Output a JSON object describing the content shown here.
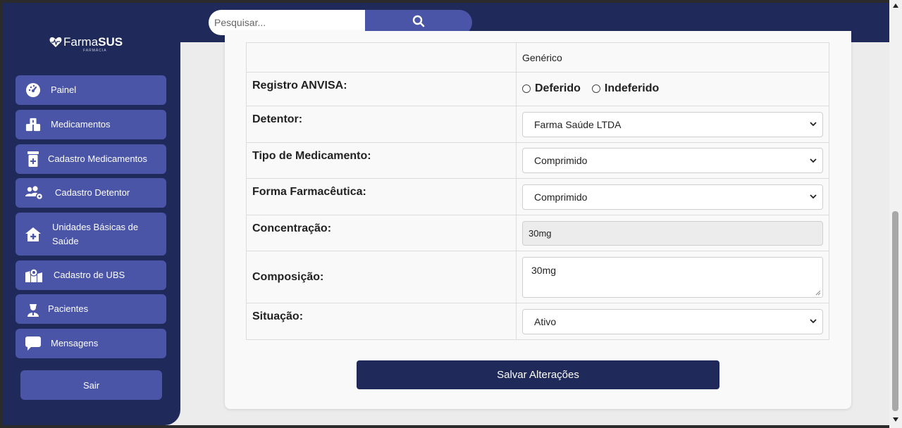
{
  "search": {
    "placeholder": "Pesquisar...",
    "button_icon": "search-icon"
  },
  "logo": {
    "prefix": "Farma",
    "bold": "SUS",
    "sub": "FARMÁCIA"
  },
  "sidebar": {
    "items": [
      {
        "label": "Painel",
        "icon": "dashboard-icon"
      },
      {
        "label": "Medicamentos",
        "icon": "medicines-icon"
      },
      {
        "label": "Cadastro Medicamentos",
        "icon": "pill-bottle-icon"
      },
      {
        "label": "Cadastro Detentor",
        "icon": "users-gear-icon"
      },
      {
        "label": "Unidades Básicas de Saúde",
        "icon": "house-medical-icon"
      },
      {
        "label": "Cadastro de UBS",
        "icon": "map-location-icon"
      },
      {
        "label": "Pacientes",
        "icon": "patient-icon"
      },
      {
        "label": "Mensagens",
        "icon": "message-icon"
      }
    ],
    "logout_label": "Sair"
  },
  "form": {
    "generic_value": "Genérico",
    "registro": {
      "label": "Registro ANVISA:",
      "options": [
        "Deferido",
        "Indeferido"
      ]
    },
    "detentor": {
      "label": "Detentor:",
      "value": "Farma Saúde LTDA"
    },
    "tipo": {
      "label": "Tipo de Medicamento:",
      "value": "Comprimido"
    },
    "forma": {
      "label": "Forma Farmacêutica:",
      "value": "Comprimido"
    },
    "concentracao": {
      "label": "Concentração:",
      "value": "30mg"
    },
    "composicao": {
      "label": "Composição:",
      "value": "30mg"
    },
    "situacao": {
      "label": "Situação:",
      "value": "Ativo"
    },
    "save_label": "Salvar Alterações"
  },
  "colors": {
    "navy": "#1f2a5a",
    "accent": "#4a55a8"
  }
}
